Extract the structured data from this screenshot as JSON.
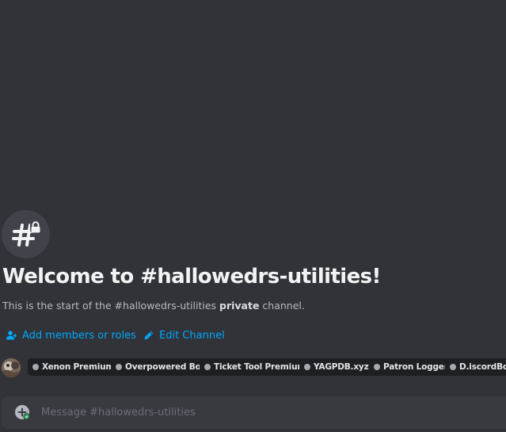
{
  "welcome": {
    "title": "Welcome to #hallowedrs-utilities!",
    "desc_before": "This is the start of the #hallowedrs-utilities ",
    "desc_bold": "private",
    "desc_after": " channel."
  },
  "actions": {
    "add_members": "Add members or roles",
    "edit_channel": "Edit Channel"
  },
  "bots": [
    {
      "label": "Xenon Premium"
    },
    {
      "label": "Overpowered Bot"
    },
    {
      "label": "Ticket Tool Premium"
    },
    {
      "label": "YAGPDB.xyz"
    },
    {
      "label": "Patron Logger"
    },
    {
      "label": "D.iscordBot"
    }
  ],
  "composer": {
    "placeholder": "Message #hallowedrs-utilities"
  },
  "icons": {
    "channel": "private-channel-hash-lock-icon",
    "add_members": "person-add-icon",
    "edit_channel": "pencil-icon",
    "composer_add": "plus-circle-icon"
  },
  "colors": {
    "background": "#313338",
    "link": "#00a8fc",
    "pill": "#1e1f22",
    "composer": "#383a40"
  }
}
